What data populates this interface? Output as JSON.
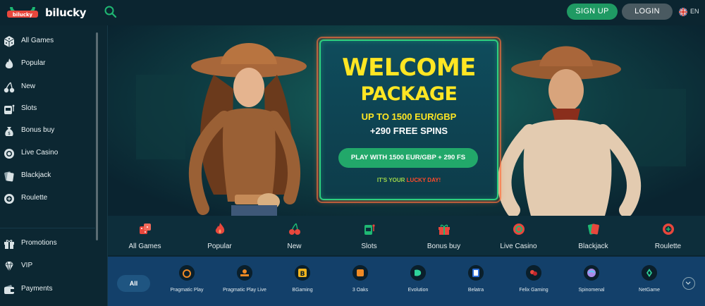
{
  "header": {
    "brand": "bilucky",
    "signup_label": "SIGN UP",
    "login_label": "LOGIN",
    "language": "EN"
  },
  "sidebar": {
    "items": [
      {
        "label": "All Games",
        "icon": "dice-icon"
      },
      {
        "label": "Popular",
        "icon": "flame-icon"
      },
      {
        "label": "New",
        "icon": "cherries-icon"
      },
      {
        "label": "Slots",
        "icon": "slot-machine-icon"
      },
      {
        "label": "Bonus buy",
        "icon": "money-bag-icon"
      },
      {
        "label": "Live Casino",
        "icon": "casino-chip-icon"
      },
      {
        "label": "Blackjack",
        "icon": "cards-icon"
      },
      {
        "label": "Roulette",
        "icon": "roulette-icon"
      }
    ],
    "secondary": [
      {
        "label": "Promotions",
        "icon": "gift-icon"
      },
      {
        "label": "VIP",
        "icon": "diamond-icon"
      },
      {
        "label": "Payments",
        "icon": "wallet-icon"
      }
    ]
  },
  "banner": {
    "title_line1": "WELCOME",
    "title_line2": "PACKAGE",
    "offer_line": "UP TO 1500 EUR/GBP",
    "spins_line": "+290 FREE SPINS",
    "cta_label": "PLAY WITH 1500 EUR/GBP + 290 FS",
    "tagline_start": "IT'S YOUR ",
    "tagline_highlight": "LUCKY DAY!"
  },
  "categories": [
    {
      "label": "All Games",
      "icon": "dice-icon"
    },
    {
      "label": "Popular",
      "icon": "flame-icon"
    },
    {
      "label": "New",
      "icon": "cherries-icon"
    },
    {
      "label": "Slots",
      "icon": "slot-machine-icon"
    },
    {
      "label": "Bonus buy",
      "icon": "gift-icon"
    },
    {
      "label": "Live Casino",
      "icon": "casino-chip-icon"
    },
    {
      "label": "Blackjack",
      "icon": "cards-icon"
    },
    {
      "label": "Roulette",
      "icon": "roulette-icon"
    }
  ],
  "providers": {
    "all_label": "All",
    "items": [
      {
        "label": "Pragmatic Play",
        "icon": "pragmatic-play-logo-icon"
      },
      {
        "label": "Pragmatic Play Live",
        "icon": "pragmatic-play-live-logo-icon"
      },
      {
        "label": "BGaming",
        "icon": "bgaming-logo-icon"
      },
      {
        "label": "3 Oaks",
        "icon": "3-oaks-logo-icon"
      },
      {
        "label": "Evolution",
        "icon": "evolution-logo-icon"
      },
      {
        "label": "Belatra",
        "icon": "belatra-logo-icon"
      },
      {
        "label": "Felix Gaming",
        "icon": "felix-gaming-logo-icon"
      },
      {
        "label": "Spinomenal",
        "icon": "spinomenal-logo-icon"
      },
      {
        "label": "NetGame",
        "icon": "netgame-logo-icon"
      }
    ]
  },
  "colors": {
    "accent_green": "#1f9a63",
    "promo_yellow": "#ffe623",
    "icon_red": "#e8473c",
    "icon_green": "#1fb873",
    "background": "#0b2530"
  }
}
